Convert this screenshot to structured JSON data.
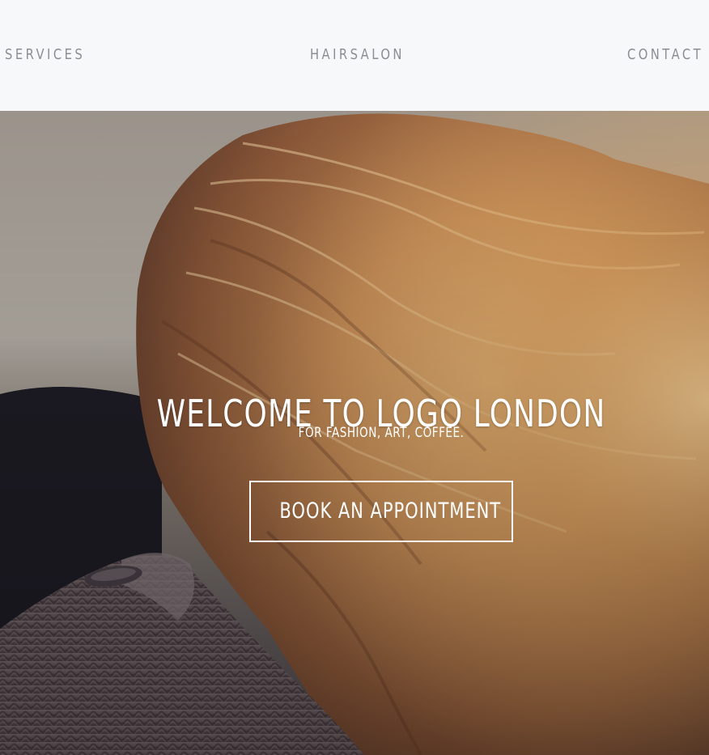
{
  "nav": {
    "left_link": "SERVICES",
    "brand": "HAIRSALON",
    "right_link": "CONTACT"
  },
  "hero": {
    "title": "WELCOME TO LOGO LONDON",
    "subtitle": "FOR FASHION, ART, COFFEE.",
    "button_label": "BOOK AN APPOINTMENT"
  },
  "colors": {
    "header_bg": "#f7f8fa",
    "nav_text": "#8a8d93",
    "hero_text": "#ffffff"
  }
}
